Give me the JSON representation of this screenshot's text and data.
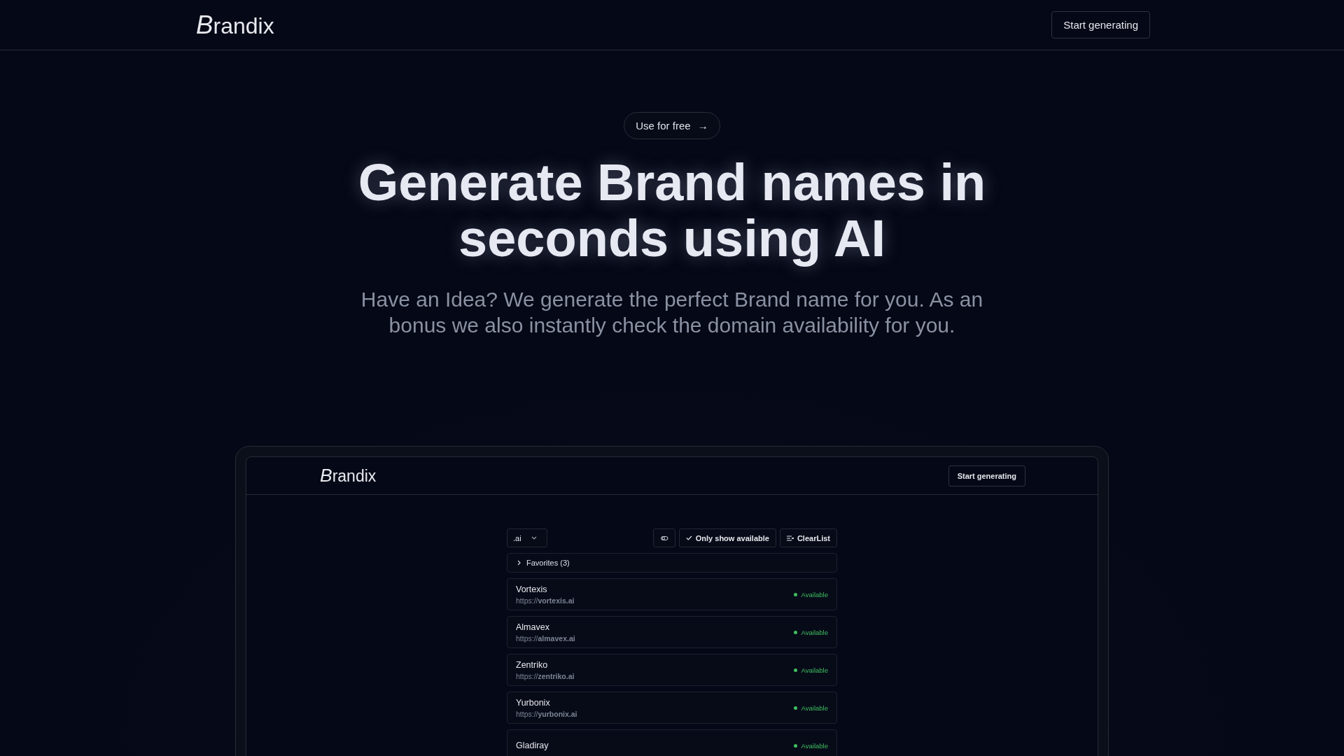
{
  "header": {
    "logo": "Brandix",
    "button": "Start generating"
  },
  "hero": {
    "pill": "Use for free",
    "pill_icon": "→",
    "title": "Generate Brand names in seconds using AI",
    "subtitle": "Have an Idea? We generate the perfect Brand name for you. As an bonus we also instantly check the domain availability for you."
  },
  "preview": {
    "header": {
      "logo": "Brandix",
      "button": "Start generating"
    },
    "toolbar": {
      "tld": ".ai",
      "only_available": {
        "label": "Only show available",
        "checked": true
      },
      "clear": "ClearList"
    },
    "favorites": {
      "label": "Favorites (3)",
      "expanded": false
    },
    "results": [
      {
        "name": "Vortexis",
        "url": "https://**vortexis.ai**",
        "status": "Available",
        "available": true
      },
      {
        "name": "Almavex",
        "url": "https://**almavex.ai**",
        "status": "Available",
        "available": true
      },
      {
        "name": "Zentriko",
        "url": "https://**zentriko.ai**",
        "status": "Available",
        "available": true
      },
      {
        "name": "Yurbonix",
        "url": "https://**yurbonix.ai**",
        "status": "Available",
        "available": true
      },
      {
        "name": "Gladiray",
        "status": "Available",
        "available": true
      }
    ]
  }
}
